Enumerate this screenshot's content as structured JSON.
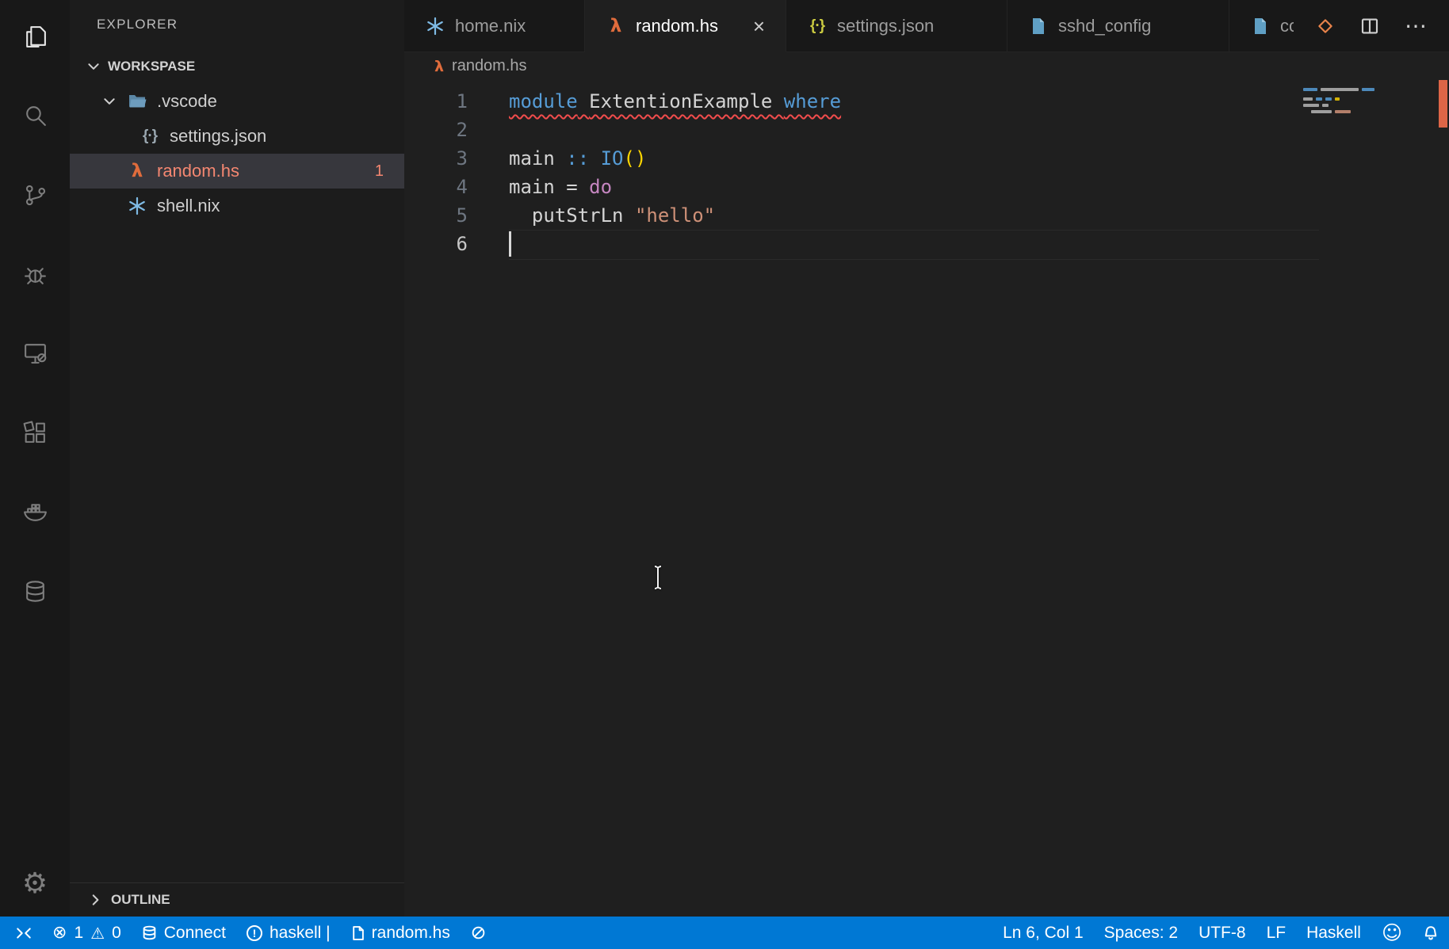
{
  "colors": {
    "status_bar_bg": "#0078d4",
    "keyword_blue": "#569cd6",
    "keyword_control": "#c586c0",
    "string_orange": "#ce9178",
    "bracket_gold": "#ffd700",
    "error_squiggle": "#f14c4c",
    "error_file_text": "#f48771",
    "overview_error_mark": "#e8694a",
    "nix_icon_blue": "#7ebae4",
    "haskell_icon_orange": "#e06c3c",
    "selected_row_bg": "#37373d"
  },
  "icons": {
    "close": "×",
    "more_actions": "⋯",
    "manage_gear": "⚙",
    "error": "⊗",
    "warning": "⚠",
    "feedback_smiley": "☺",
    "haskell_lambda": "λ",
    "json_braces": "{·}",
    "exclamation": "!"
  },
  "activity_bar": {
    "items": [
      {
        "name": "explorer",
        "active": true
      },
      {
        "name": "search"
      },
      {
        "name": "source-control"
      },
      {
        "name": "run-debug"
      },
      {
        "name": "remote-explorer"
      },
      {
        "name": "extensions"
      },
      {
        "name": "docker"
      },
      {
        "name": "database"
      }
    ],
    "bottom": [
      {
        "name": "manage"
      }
    ]
  },
  "sidebar": {
    "title": "EXPLORER",
    "section_label": "WORKSPASE",
    "files": [
      {
        "label": ".vscode",
        "type": "folder",
        "expanded": true
      },
      {
        "label": "settings.json",
        "type": "json",
        "child": true
      },
      {
        "label": "random.hs",
        "type": "haskell",
        "selected": true,
        "badge": "1"
      },
      {
        "label": "shell.nix",
        "type": "nix"
      }
    ],
    "outline_label": "OUTLINE"
  },
  "tabs": {
    "items": [
      {
        "label": "home.nix",
        "icon": "nix"
      },
      {
        "label": "random.hs",
        "icon": "haskell",
        "active": true
      },
      {
        "label": "settings.json",
        "icon": "json"
      },
      {
        "label": "sshd_config",
        "icon": "file"
      },
      {
        "label": "co",
        "icon": "file",
        "truncated": true
      }
    ]
  },
  "breadcrumb": {
    "file_label": "random.hs"
  },
  "editor": {
    "lines": [
      {
        "num": "1",
        "tokens": [
          {
            "t": "module"
          },
          {
            "t": " "
          },
          {
            "t": "ExtentionExample"
          },
          {
            "t": " "
          },
          {
            "t": "where"
          }
        ]
      },
      {
        "num": "2",
        "tokens": []
      },
      {
        "num": "3",
        "tokens": [
          {
            "t": "main"
          },
          {
            "t": " "
          },
          {
            "t": "::"
          },
          {
            "t": " "
          },
          {
            "t": "IO"
          },
          {
            "t": "()"
          }
        ]
      },
      {
        "num": "4",
        "tokens": [
          {
            "t": "main = "
          },
          {
            "t": "do"
          }
        ]
      },
      {
        "num": "5",
        "tokens": [
          {
            "t": "  putStrLn "
          },
          {
            "t": "\"hello\""
          }
        ]
      },
      {
        "num": "6",
        "tokens": []
      }
    ]
  },
  "status_bar": {
    "left": {
      "errors": "1",
      "warnings": "0",
      "connect_label": "Connect",
      "haskell_label": "haskell |",
      "task_label": "random.hs"
    },
    "right": {
      "cursor_position": "Ln 6, Col 1",
      "indentation": "Spaces: 2",
      "encoding": "UTF-8",
      "eol": "LF",
      "language": "Haskell"
    }
  }
}
